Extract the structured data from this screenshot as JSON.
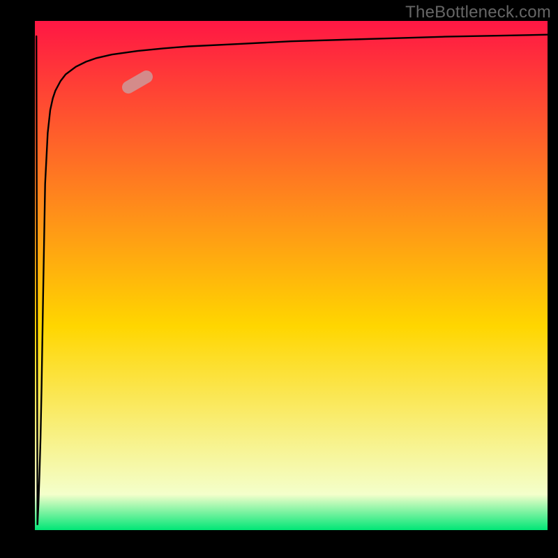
{
  "attribution": "TheBottleneck.com",
  "colors": {
    "gradient_top": "#ff1744",
    "gradient_mid": "#ffd600",
    "gradient_bottom": "#00e676",
    "frame": "#000000",
    "curve": "#000000",
    "marker": "#cc9999"
  },
  "chart_data": {
    "type": "line",
    "title": "",
    "xlabel": "",
    "ylabel": "",
    "xlim": [
      0,
      100
    ],
    "ylim": [
      0,
      100
    ],
    "x": [
      0.5,
      0.7,
      0.9,
      1.1,
      1.3,
      1.6,
      2,
      2.5,
      3,
      3.5,
      4,
      5,
      6,
      8,
      10,
      12,
      15,
      20,
      25,
      30,
      40,
      50,
      60,
      70,
      80,
      90,
      100
    ],
    "series": [
      {
        "name": "bottleneck-curve",
        "values": [
          1,
          5,
          11,
          18,
          28,
          46,
          68,
          78,
          82.5,
          84.8,
          86.3,
          88.2,
          89.5,
          91,
          92,
          92.7,
          93.4,
          94.1,
          94.6,
          95,
          95.5,
          96,
          96.3,
          96.6,
          96.9,
          97.1,
          97.3
        ]
      }
    ],
    "marker": {
      "x": 20,
      "y": 88,
      "angle_deg": 30
    },
    "annotations": []
  }
}
